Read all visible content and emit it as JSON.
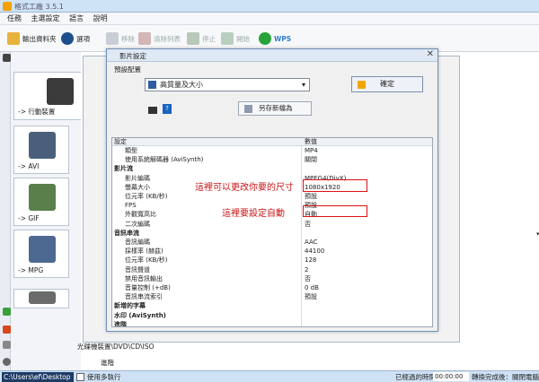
{
  "app": {
    "title": "格式工廠 3.5.1"
  },
  "menu": [
    "任務",
    "主選設定",
    "語言",
    "說明"
  ],
  "toolbar": [
    {
      "label": "輸出資料夾",
      "enabled": true
    },
    {
      "label": "選項",
      "enabled": true
    },
    {
      "label": "移除",
      "enabled": false
    },
    {
      "label": "清除列表",
      "enabled": false
    },
    {
      "label": "停止",
      "enabled": false
    },
    {
      "label": "開始",
      "enabled": false
    },
    {
      "label": "WPS",
      "enabled": true
    }
  ],
  "categories": [
    "-> 行動裝置",
    "-> AVI",
    "-> GIF",
    "-> MPG"
  ],
  "dialog": {
    "title": "影片設定",
    "preset_label": "預設配置",
    "preset_value": "高質量及大小",
    "ok_label": "確定",
    "save_as_label": "另存新檔為",
    "help_glyph": "?"
  },
  "table": {
    "headers": {
      "setting": "設定",
      "value": "數值"
    },
    "rows": [
      {
        "k": "類型",
        "v": "MP4",
        "bold": false
      },
      {
        "k": "使用系統解碼器 (AviSynth)",
        "v": "關閉",
        "bold": false
      },
      {
        "k": "影片流",
        "v": "",
        "bold": true
      },
      {
        "k": "影片編碼",
        "v": "MPEG4(DivX)",
        "bold": false
      },
      {
        "k": "螢幕大小",
        "v": "1080x1920",
        "bold": false
      },
      {
        "k": "位元率 (KB/秒)",
        "v": "預設",
        "bold": false
      },
      {
        "k": "FPS",
        "v": "預設",
        "bold": false
      },
      {
        "k": "外觀寬高比",
        "v": "自動",
        "bold": false
      },
      {
        "k": "二次編碼",
        "v": "否",
        "bold": false
      },
      {
        "k": "音訊串流",
        "v": "",
        "bold": true
      },
      {
        "k": "音訊編碼",
        "v": "AAC",
        "bold": false
      },
      {
        "k": "採樣率 (赫茲)",
        "v": "44100",
        "bold": false
      },
      {
        "k": "位元率 (KB/秒)",
        "v": "128",
        "bold": false
      },
      {
        "k": "音訊聲道",
        "v": "2",
        "bold": false
      },
      {
        "k": "禁用音訊輸出",
        "v": "否",
        "bold": false
      },
      {
        "k": "音量控制 (+dB)",
        "v": "0 dB",
        "bold": false
      },
      {
        "k": "音訊串流索引",
        "v": "預設",
        "bold": false
      },
      {
        "k": "新增的字幕",
        "v": "",
        "bold": true
      },
      {
        "k": "水印 (AviSynth)",
        "v": "",
        "bold": true
      },
      {
        "k": "進階",
        "v": "",
        "bold": true
      }
    ]
  },
  "annotations": {
    "size_note": "這裡可以更改你要的尺寸",
    "ratio_note": "這裡要設定自動"
  },
  "footer": {
    "optical": "光碟機裝置\\DVD\\CD\\ISO",
    "advanced": "進階"
  },
  "statusbar": {
    "path": "C:\\Users\\ef\\Desktop",
    "multi_thread": "使用多執行",
    "elapsed_label": "已經過的時間：",
    "elapsed_time": "00:00:00",
    "after_done": "轉換完成後：關閉電腦"
  },
  "colors": {
    "accent": "#2d5d9f",
    "annotation": "#e01010",
    "status_path_bg": "#1e3b66"
  }
}
